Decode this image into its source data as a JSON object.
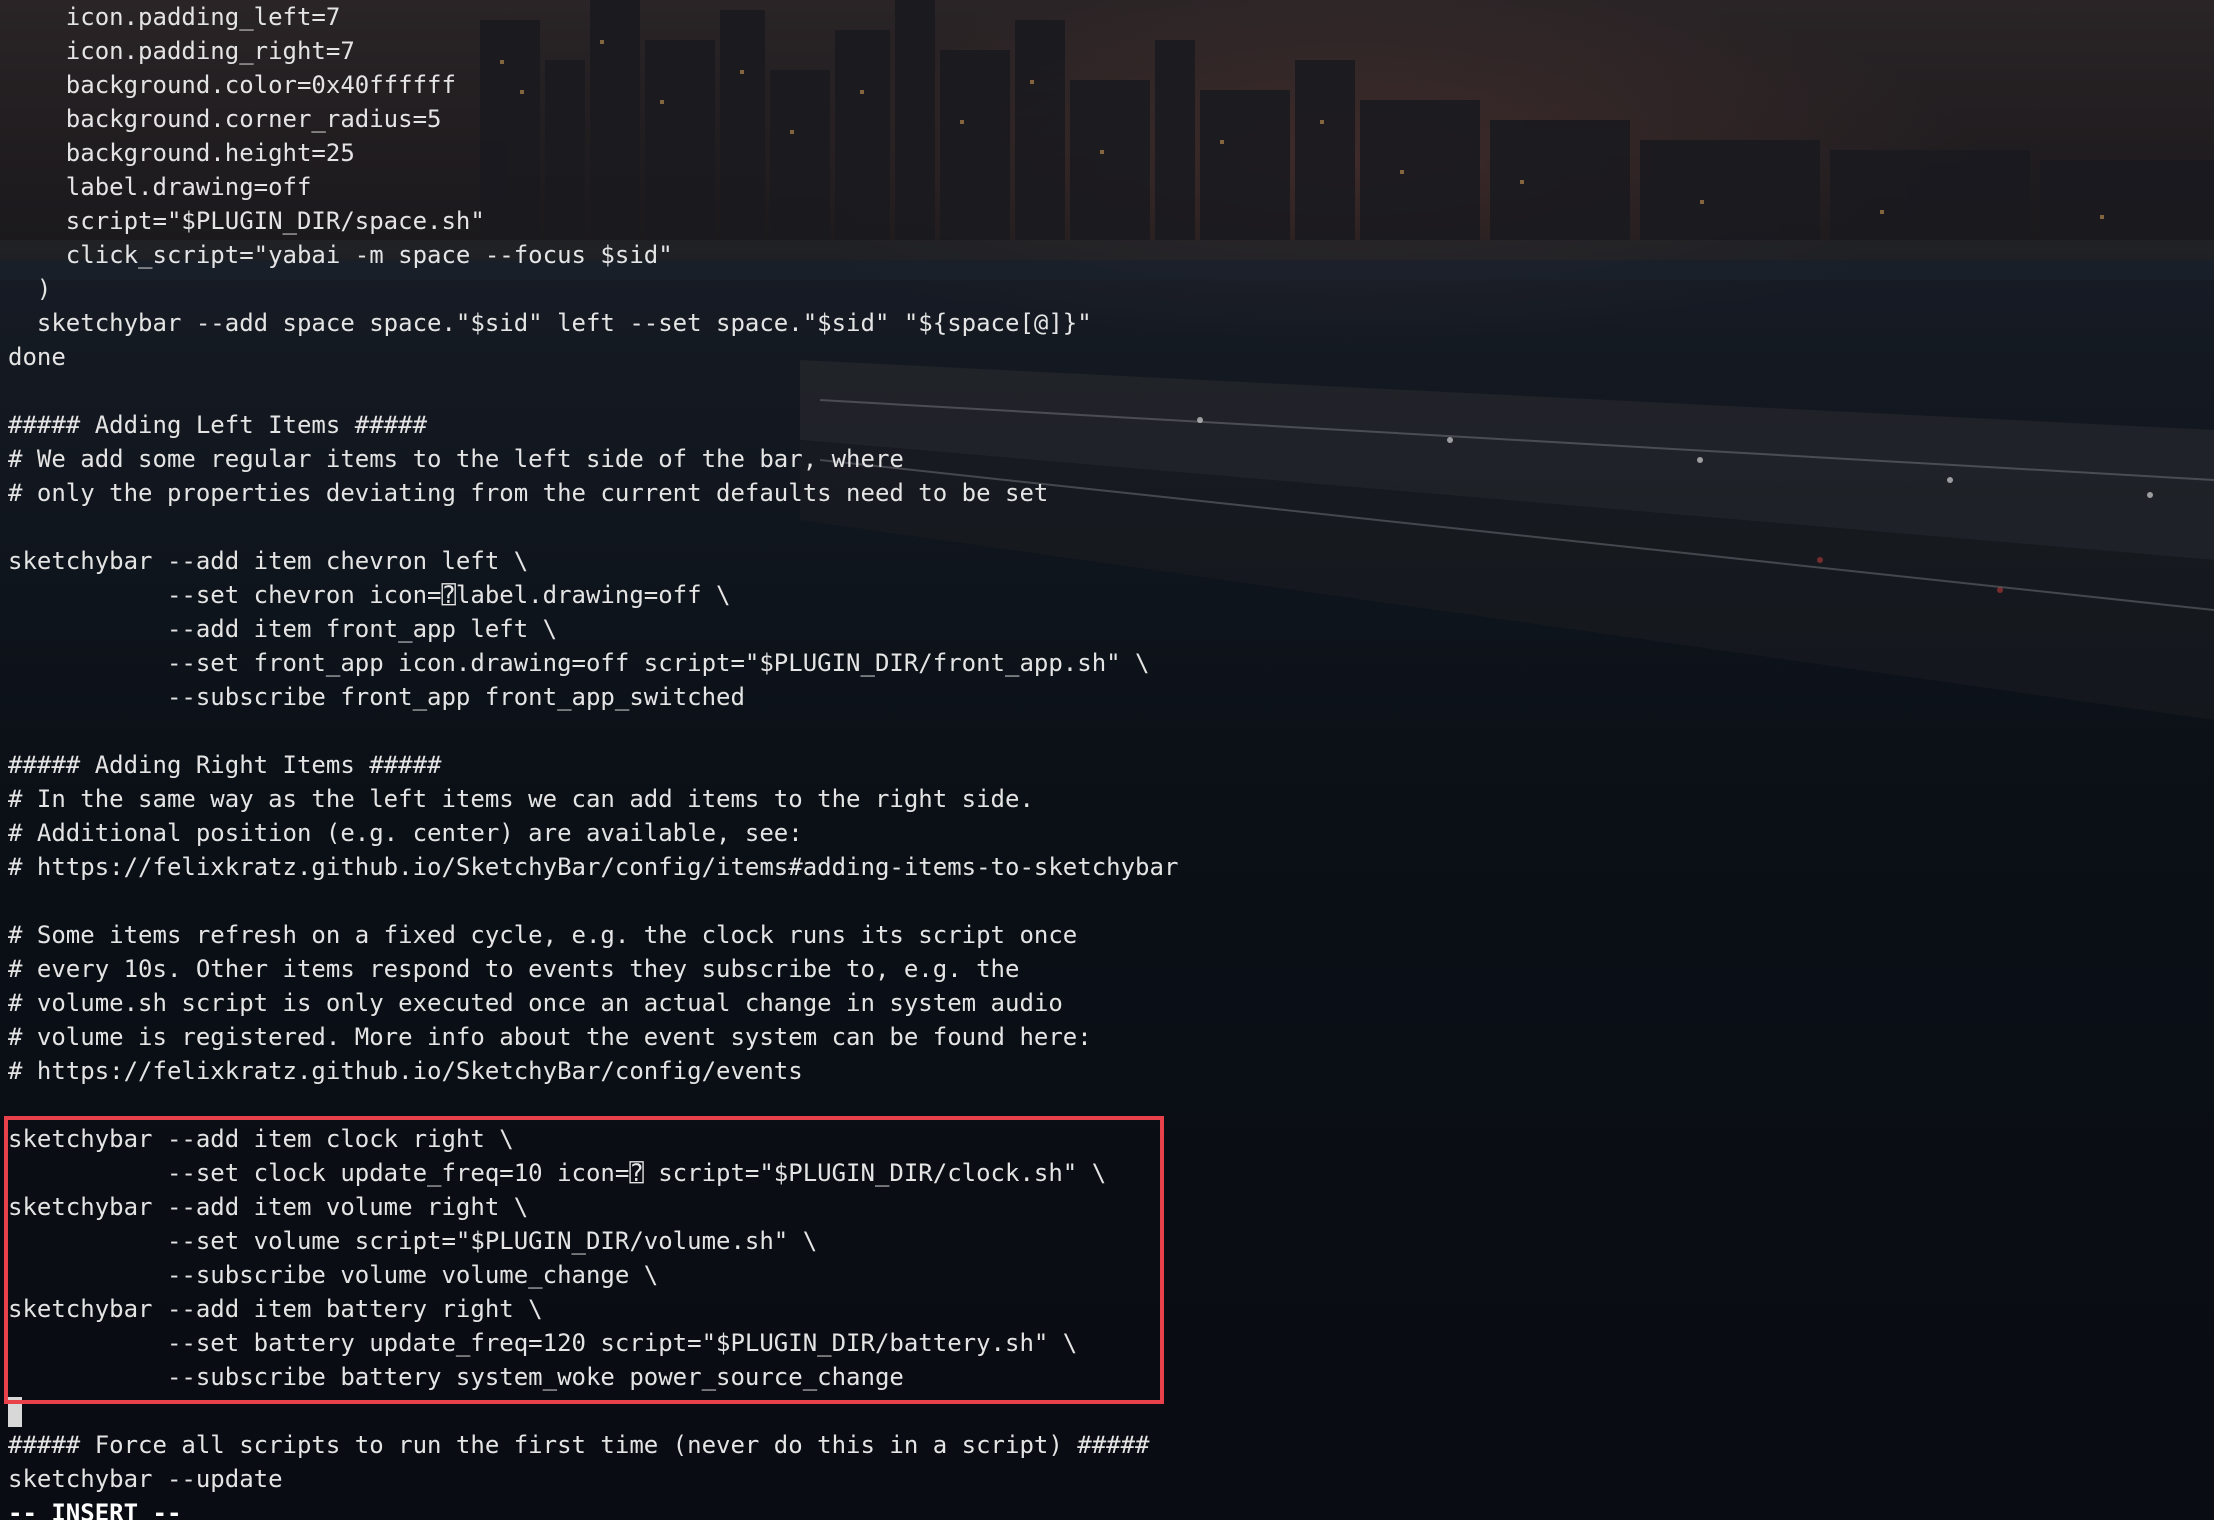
{
  "terminal": {
    "lines": [
      "    icon.padding_left=7",
      "    icon.padding_right=7",
      "    background.color=0x40ffffff",
      "    background.corner_radius=5",
      "    background.height=25",
      "    label.drawing=off",
      "    script=\"$PLUGIN_DIR/space.sh\"",
      "    click_script=\"yabai -m space --focus $sid\"",
      "  )",
      "  sketchybar --add space space.\"$sid\" left --set space.\"$sid\" \"${space[@]}\"",
      "done",
      "",
      "##### Adding Left Items #####",
      "# We add some regular items to the left side of the bar, where",
      "# only the properties deviating from the current defaults need to be set",
      "",
      "sketchybar --add item chevron left \\",
      "           --set chevron icon=⍰label.drawing=off \\",
      "           --add item front_app left \\",
      "           --set front_app icon.drawing=off script=\"$PLUGIN_DIR/front_app.sh\" \\",
      "           --subscribe front_app front_app_switched",
      "",
      "##### Adding Right Items #####",
      "# In the same way as the left items we can add items to the right side.",
      "# Additional position (e.g. center) are available, see:",
      "# https://felixkratz.github.io/SketchyBar/config/items#adding-items-to-sketchybar",
      "",
      "# Some items refresh on a fixed cycle, e.g. the clock runs its script once",
      "# every 10s. Other items respond to events they subscribe to, e.g. the",
      "# volume.sh script is only executed once an actual change in system audio",
      "# volume is registered. More info about the event system can be found here:",
      "# https://felixkratz.github.io/SketchyBar/config/events",
      "",
      "sketchybar --add item clock right \\",
      "           --set clock update_freq=10 icon=⍰ script=\"$PLUGIN_DIR/clock.sh\" \\",
      "sketchybar --add item volume right \\",
      "           --set volume script=\"$PLUGIN_DIR/volume.sh\" \\",
      "           --subscribe volume volume_change \\",
      "sketchybar --add item battery right \\",
      "           --set battery update_freq=120 script=\"$PLUGIN_DIR/battery.sh\" \\",
      "           --subscribe battery system_woke power_source_change",
      "",
      "##### Force all scripts to run the first time (never do this in a script) #####",
      "sketchybar --update"
    ],
    "mode": "-- INSERT --"
  },
  "colors": {
    "text": "#e4e4e4",
    "highlight_border": "#e8414a",
    "cursor": "#d8d8d8"
  }
}
